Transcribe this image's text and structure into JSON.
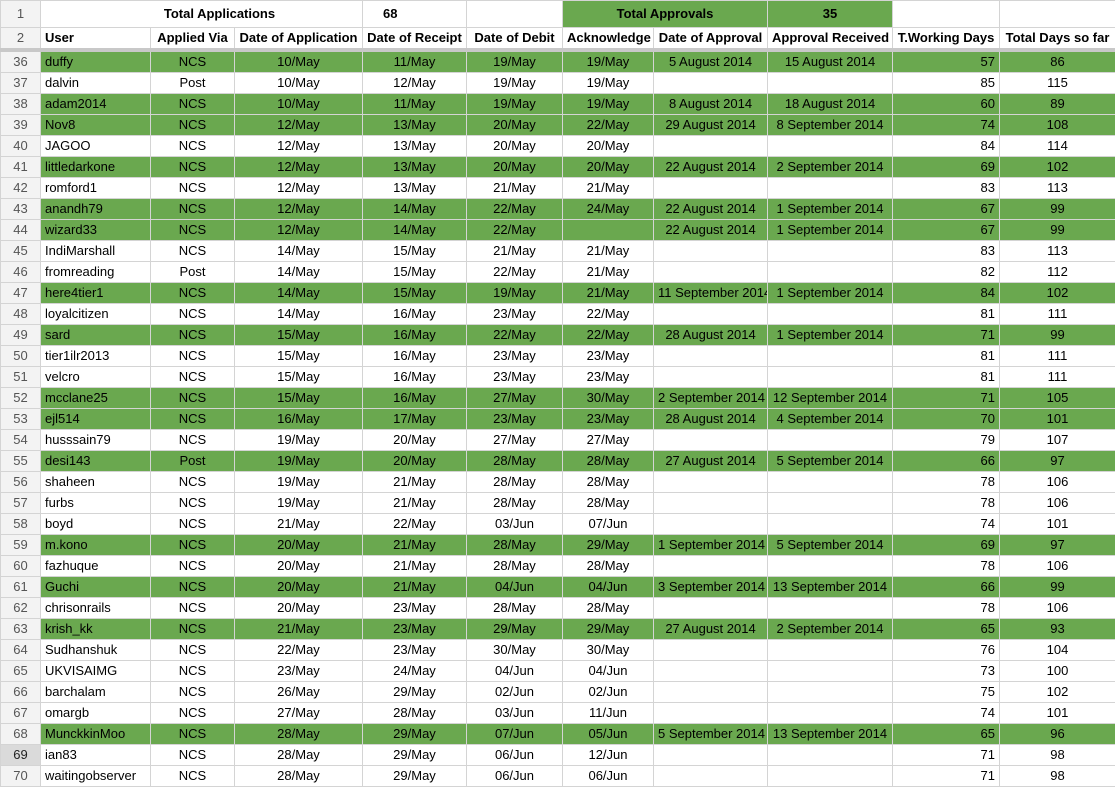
{
  "summary": {
    "row_numbers": [
      "1",
      "2"
    ],
    "total_applications_label": "Total Applications",
    "total_applications_value": "68",
    "total_approvals_label": "Total Approvals",
    "total_approvals_value": "35"
  },
  "headers": [
    "User",
    "Applied Via",
    "Date of Application",
    "Date of Receipt",
    "Date of Debit",
    "Acknowledge",
    "Date of Approval",
    "Approval Received",
    "T.Working Days",
    "Total Days so far"
  ],
  "colors": {
    "approved_row": "#6aa84f",
    "grid": "#d4d4d4",
    "row_header": "#f3f3f3"
  },
  "rows": [
    {
      "rn": "36",
      "user": "duffy",
      "via": "NCS",
      "app": "10/May",
      "rec": "11/May",
      "debit": "19/May",
      "ack": "19/May",
      "approval": "5 August 2014",
      "received": "15 August 2014",
      "twd": "57",
      "total": "86",
      "approved": true
    },
    {
      "rn": "37",
      "user": "dalvin",
      "via": "Post",
      "app": "10/May",
      "rec": "12/May",
      "debit": "19/May",
      "ack": "19/May",
      "approval": "",
      "received": "",
      "twd": "85",
      "total": "115",
      "approved": false
    },
    {
      "rn": "38",
      "user": "adam2014",
      "via": "NCS",
      "app": "10/May",
      "rec": "11/May",
      "debit": "19/May",
      "ack": "19/May",
      "approval": "8 August 2014",
      "received": "18 August 2014",
      "twd": "60",
      "total": "89",
      "approved": true
    },
    {
      "rn": "39",
      "user": "Nov8",
      "via": "NCS",
      "app": "12/May",
      "rec": "13/May",
      "debit": "20/May",
      "ack": "22/May",
      "approval": "29 August 2014",
      "received": "8 September 2014",
      "twd": "74",
      "total": "108",
      "approved": true
    },
    {
      "rn": "40",
      "user": "JAGOO",
      "via": "NCS",
      "app": "12/May",
      "rec": "13/May",
      "debit": "20/May",
      "ack": "20/May",
      "approval": "",
      "received": "",
      "twd": "84",
      "total": "114",
      "approved": false
    },
    {
      "rn": "41",
      "user": "littledarkone",
      "via": "NCS",
      "app": "12/May",
      "rec": "13/May",
      "debit": "20/May",
      "ack": "20/May",
      "approval": "22 August 2014",
      "received": "2 September 2014",
      "twd": "69",
      "total": "102",
      "approved": true
    },
    {
      "rn": "42",
      "user": "romford1",
      "via": "NCS",
      "app": "12/May",
      "rec": "13/May",
      "debit": "21/May",
      "ack": "21/May",
      "approval": "",
      "received": "",
      "twd": "83",
      "total": "113",
      "approved": false
    },
    {
      "rn": "43",
      "user": "anandh79",
      "via": "NCS",
      "app": "12/May",
      "rec": "14/May",
      "debit": "22/May",
      "ack": "24/May",
      "approval": "22 August 2014",
      "received": "1 September 2014",
      "twd": "67",
      "total": "99",
      "approved": true
    },
    {
      "rn": "44",
      "user": "wizard33",
      "via": "NCS",
      "app": "12/May",
      "rec": "14/May",
      "debit": "22/May",
      "ack": "",
      "approval": "22 August 2014",
      "received": "1 September 2014",
      "twd": "67",
      "total": "99",
      "approved": true
    },
    {
      "rn": "45",
      "user": "IndiMarshall",
      "via": "NCS",
      "app": "14/May",
      "rec": "15/May",
      "debit": "21/May",
      "ack": "21/May",
      "approval": "",
      "received": "",
      "twd": "83",
      "total": "113",
      "approved": false
    },
    {
      "rn": "46",
      "user": "fromreading",
      "via": "Post",
      "app": "14/May",
      "rec": "15/May",
      "debit": "22/May",
      "ack": "21/May",
      "approval": "",
      "received": "",
      "twd": "82",
      "total": "112",
      "approved": false
    },
    {
      "rn": "47",
      "user": "here4tier1",
      "via": "NCS",
      "app": "14/May",
      "rec": "15/May",
      "debit": "19/May",
      "ack": "21/May",
      "approval": "11 September 2014",
      "received": "1 September 2014",
      "twd": "84",
      "total": "102",
      "approved": true
    },
    {
      "rn": "48",
      "user": "loyalcitizen",
      "via": "NCS",
      "app": "14/May",
      "rec": "16/May",
      "debit": "23/May",
      "ack": "22/May",
      "approval": "",
      "received": "",
      "twd": "81",
      "total": "111",
      "approved": false
    },
    {
      "rn": "49",
      "user": "sard",
      "via": "NCS",
      "app": "15/May",
      "rec": "16/May",
      "debit": "22/May",
      "ack": "22/May",
      "approval": "28 August 2014",
      "received": "1 September 2014",
      "twd": "71",
      "total": "99",
      "approved": true
    },
    {
      "rn": "50",
      "user": "tier1ilr2013",
      "via": "NCS",
      "app": "15/May",
      "rec": "16/May",
      "debit": "23/May",
      "ack": "23/May",
      "approval": "",
      "received": "",
      "twd": "81",
      "total": "111",
      "approved": false
    },
    {
      "rn": "51",
      "user": "velcro",
      "via": "NCS",
      "app": "15/May",
      "rec": "16/May",
      "debit": "23/May",
      "ack": "23/May",
      "approval": "",
      "received": "",
      "twd": "81",
      "total": "111",
      "approved": false
    },
    {
      "rn": "52",
      "user": "mcclane25",
      "via": "NCS",
      "app": "15/May",
      "rec": "16/May",
      "debit": "27/May",
      "ack": "30/May",
      "approval": "2 September 2014",
      "received": "12 September 2014",
      "twd": "71",
      "total": "105",
      "approved": true
    },
    {
      "rn": "53",
      "user": "ejl514",
      "via": "NCS",
      "app": "16/May",
      "rec": "17/May",
      "debit": "23/May",
      "ack": "23/May",
      "approval": "28 August 2014",
      "received": "4 September 2014",
      "twd": "70",
      "total": "101",
      "approved": true
    },
    {
      "rn": "54",
      "user": "husssain79",
      "via": "NCS",
      "app": "19/May",
      "rec": "20/May",
      "debit": "27/May",
      "ack": "27/May",
      "approval": "",
      "received": "",
      "twd": "79",
      "total": "107",
      "approved": false
    },
    {
      "rn": "55",
      "user": "desi143",
      "via": "Post",
      "app": "19/May",
      "rec": "20/May",
      "debit": "28/May",
      "ack": "28/May",
      "approval": "27 August 2014",
      "received": "5 September 2014",
      "twd": "66",
      "total": "97",
      "approved": true
    },
    {
      "rn": "56",
      "user": "shaheen",
      "via": "NCS",
      "app": "19/May",
      "rec": "21/May",
      "debit": "28/May",
      "ack": "28/May",
      "approval": "",
      "received": "",
      "twd": "78",
      "total": "106",
      "approved": false
    },
    {
      "rn": "57",
      "user": "furbs",
      "via": "NCS",
      "app": "19/May",
      "rec": "21/May",
      "debit": "28/May",
      "ack": "28/May",
      "approval": "",
      "received": "",
      "twd": "78",
      "total": "106",
      "approved": false
    },
    {
      "rn": "58",
      "user": "boyd",
      "via": "NCS",
      "app": "21/May",
      "rec": "22/May",
      "debit": "03/Jun",
      "ack": "07/Jun",
      "approval": "",
      "received": "",
      "twd": "74",
      "total": "101",
      "approved": false
    },
    {
      "rn": "59",
      "user": "m.kono",
      "via": "NCS",
      "app": "20/May",
      "rec": "21/May",
      "debit": "28/May",
      "ack": "29/May",
      "approval": "1 September 2014",
      "received": "5 September 2014",
      "twd": "69",
      "total": "97",
      "approved": true
    },
    {
      "rn": "60",
      "user": "fazhuque",
      "via": "NCS",
      "app": "20/May",
      "rec": "21/May",
      "debit": "28/May",
      "ack": "28/May",
      "approval": "",
      "received": "",
      "twd": "78",
      "total": "106",
      "approved": false
    },
    {
      "rn": "61",
      "user": "Guchi",
      "via": "NCS",
      "app": "20/May",
      "rec": "21/May",
      "debit": "04/Jun",
      "ack": "04/Jun",
      "approval": "3 September 2014",
      "received": "13 September 2014",
      "twd": "66",
      "total": "99",
      "approved": true
    },
    {
      "rn": "62",
      "user": "chrisonrails",
      "via": "NCS",
      "app": "20/May",
      "rec": "23/May",
      "debit": "28/May",
      "ack": "28/May",
      "approval": "",
      "received": "",
      "twd": "78",
      "total": "106",
      "approved": false
    },
    {
      "rn": "63",
      "user": "krish_kk",
      "via": "NCS",
      "app": "21/May",
      "rec": "23/May",
      "debit": "29/May",
      "ack": "29/May",
      "approval": "27 August 2014",
      "received": "2 September 2014",
      "twd": "65",
      "total": "93",
      "approved": true
    },
    {
      "rn": "64",
      "user": "Sudhanshuk",
      "via": "NCS",
      "app": "22/May",
      "rec": "23/May",
      "debit": "30/May",
      "ack": "30/May",
      "approval": "",
      "received": "",
      "twd": "76",
      "total": "104",
      "approved": false
    },
    {
      "rn": "65",
      "user": "UKVISAIMG",
      "via": "NCS",
      "app": "23/May",
      "rec": "24/May",
      "debit": "04/Jun",
      "ack": "04/Jun",
      "approval": "",
      "received": "",
      "twd": "73",
      "total": "100",
      "approved": false
    },
    {
      "rn": "66",
      "user": "barchalam",
      "via": "NCS",
      "app": "26/May",
      "rec": "29/May",
      "debit": "02/Jun",
      "ack": "02/Jun",
      "approval": "",
      "received": "",
      "twd": "75",
      "total": "102",
      "approved": false
    },
    {
      "rn": "67",
      "user": "omargb",
      "via": "NCS",
      "app": "27/May",
      "rec": "28/May",
      "debit": "03/Jun",
      "ack": "11/Jun",
      "approval": "",
      "received": "",
      "twd": "74",
      "total": "101",
      "approved": false
    },
    {
      "rn": "68",
      "user": "MunckkinMoo",
      "via": "NCS",
      "app": "28/May",
      "rec": "29/May",
      "debit": "07/Jun",
      "ack": "05/Jun",
      "approval": "5 September 2014",
      "received": "13 September 2014",
      "twd": "65",
      "total": "96",
      "approved": true
    },
    {
      "rn": "69",
      "user": "ian83",
      "via": "NCS",
      "app": "28/May",
      "rec": "29/May",
      "debit": "06/Jun",
      "ack": "12/Jun",
      "approval": "",
      "received": "",
      "twd": "71",
      "total": "98",
      "approved": false,
      "selected": true
    },
    {
      "rn": "70",
      "user": "waitingobserver",
      "via": "NCS",
      "app": "28/May",
      "rec": "29/May",
      "debit": "06/Jun",
      "ack": "06/Jun",
      "approval": "",
      "received": "",
      "twd": "71",
      "total": "98",
      "approved": false
    }
  ]
}
